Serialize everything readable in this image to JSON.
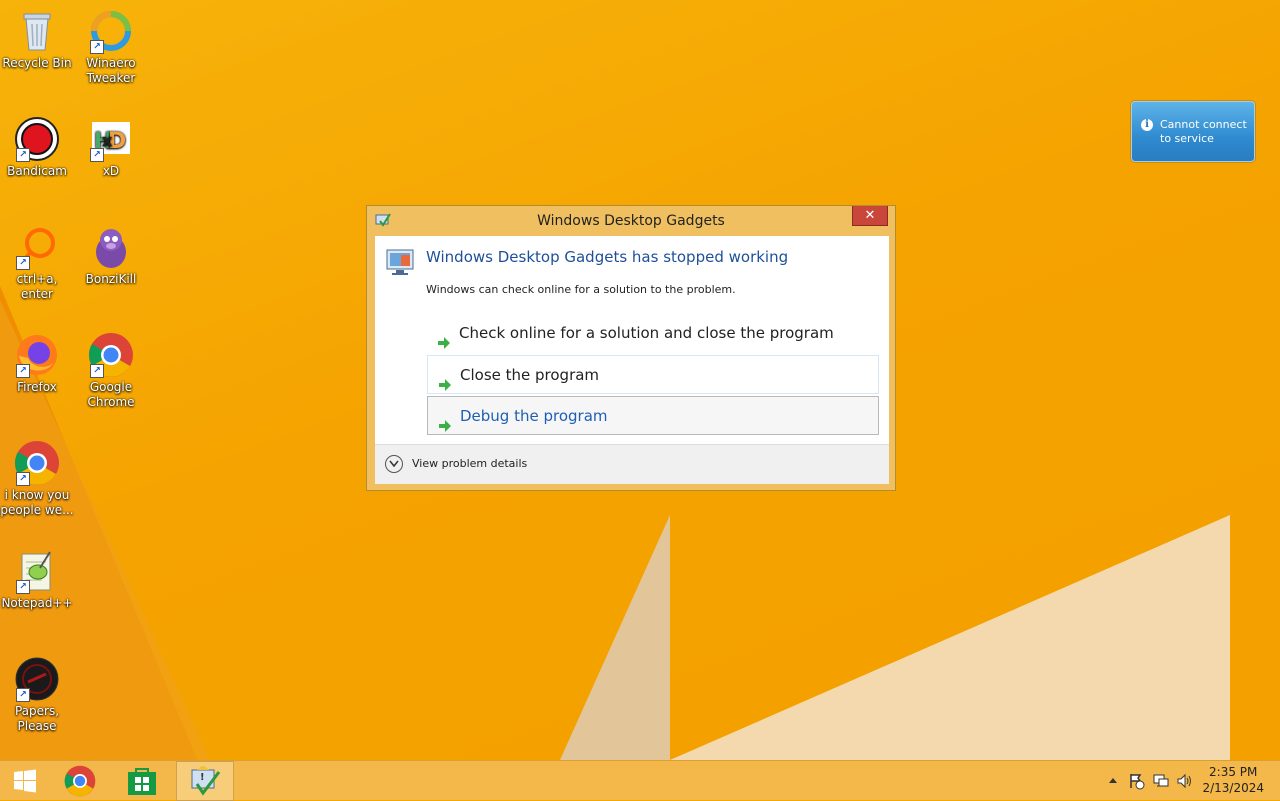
{
  "desktop": {
    "icons": [
      {
        "label": "Recycle Bin",
        "icon": "recycle-bin-icon"
      },
      {
        "label": "Winaero Tweaker",
        "icon": "winaero-tweaker-icon"
      },
      {
        "label": "Bandicam",
        "icon": "bandicam-icon"
      },
      {
        "label": "xD",
        "icon": "xd-icon"
      },
      {
        "label": "ctrl+a, enter",
        "icon": "ctrl-a-enter-icon"
      },
      {
        "label": "BonziKill",
        "icon": "bonzikill-icon"
      },
      {
        "label": "Firefox",
        "icon": "firefox-icon"
      },
      {
        "label": "Google Chrome",
        "icon": "chrome-icon"
      },
      {
        "label": "i know you people we...",
        "icon": "chrome-icon"
      },
      {
        "label": "Notepad++",
        "icon": "notepadpp-icon"
      },
      {
        "label": "Papers, Please",
        "icon": "papers-please-icon"
      }
    ]
  },
  "dialog": {
    "title": "Windows Desktop Gadgets",
    "close_label": "✕",
    "heading": "Windows Desktop Gadgets has stopped working",
    "subtext": "Windows can check online for a solution to the problem.",
    "options": [
      "Check online for a solution and close the program",
      "Close the program",
      "Debug the program"
    ],
    "details_label": "View problem details"
  },
  "gadget": {
    "message": "Cannot connect to service"
  },
  "taskbar": {
    "buttons": [
      {
        "name": "start",
        "icon": "windows-logo-icon"
      },
      {
        "name": "chrome",
        "icon": "chrome-icon"
      },
      {
        "name": "store",
        "icon": "store-icon"
      },
      {
        "name": "error-reporting",
        "icon": "problem-report-icon"
      }
    ],
    "clock": {
      "time": "2:35 PM",
      "date": "2/13/2024"
    }
  },
  "colors": {
    "desktop_bg": "#f5a800",
    "taskbar_bg": "#f3b74a",
    "dialog_frame": "#f0c060",
    "heading_blue": "#1e4f9a",
    "close_red": "#c9473a"
  }
}
